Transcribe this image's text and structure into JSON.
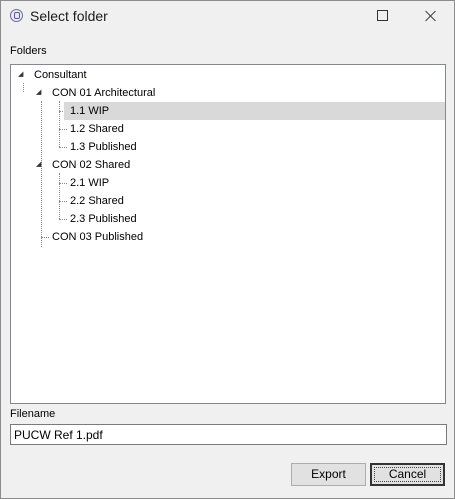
{
  "window": {
    "title": "Select folder",
    "icon": "app-icon"
  },
  "folders": {
    "label": "Folders",
    "tree": [
      {
        "label": "Consultant",
        "expanded": true,
        "children": [
          {
            "label": "CON 01 Architectural",
            "expanded": true,
            "children": [
              {
                "label": "1.1 WIP",
                "selected": true
              },
              {
                "label": "1.2 Shared"
              },
              {
                "label": "1.3 Published"
              }
            ]
          },
          {
            "label": "CON 02 Shared",
            "expanded": true,
            "children": [
              {
                "label": "2.1 WIP"
              },
              {
                "label": "2.2 Shared"
              },
              {
                "label": "2.3 Published"
              }
            ]
          },
          {
            "label": "CON 03 Published"
          }
        ]
      }
    ]
  },
  "filename": {
    "label": "Filename",
    "value": "PUCW Ref 1.pdf"
  },
  "buttons": {
    "export": "Export",
    "cancel": "Cancel"
  }
}
